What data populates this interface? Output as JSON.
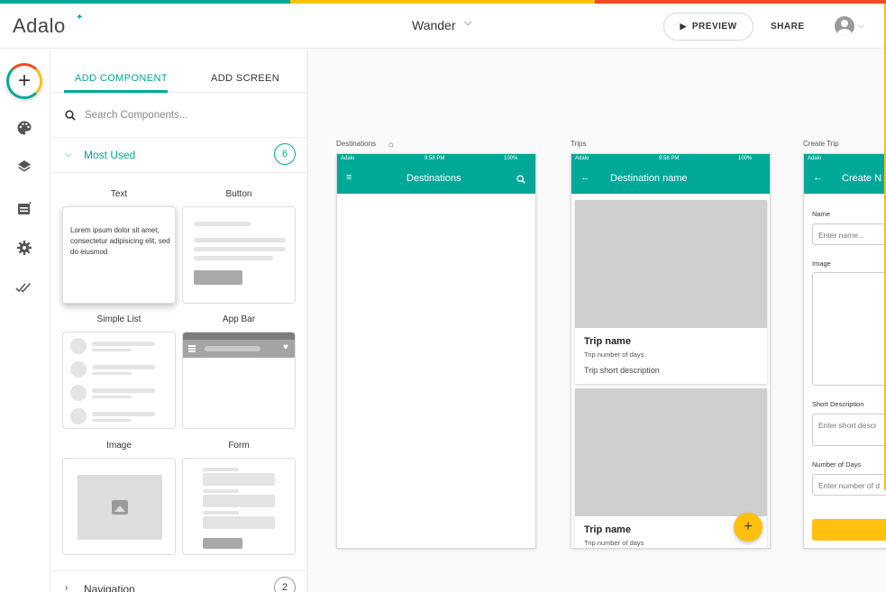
{
  "colors": {
    "brand_teal": "#00a898",
    "brand_yellow": "#ffc00e",
    "brand_red": "#f04b25"
  },
  "header": {
    "logo": "Adalo",
    "app_name": "Wander",
    "preview_label": "PREVIEW",
    "share_label": "SHARE"
  },
  "rail": {
    "icons": [
      "add-icon",
      "palette-icon",
      "layers-icon",
      "database-icon",
      "gear-icon",
      "publish-check-icon"
    ]
  },
  "panel": {
    "tabs": [
      {
        "label": "ADD COMPONENT"
      },
      {
        "label": "ADD SCREEN"
      }
    ],
    "search_placeholder": "Search Components...",
    "sections": [
      {
        "title": "Most Used",
        "count": "6"
      },
      {
        "title": "Navigation",
        "count": "2"
      }
    ],
    "components": [
      {
        "label": "Text",
        "preview_text": "Lorem ipsum dolor sit amet, consectetur adipisicing elit, sed do eiusmod"
      },
      {
        "label": "Button"
      },
      {
        "label": "Simple List"
      },
      {
        "label": "App Bar"
      },
      {
        "label": "Image"
      },
      {
        "label": "Form"
      }
    ]
  },
  "canvas": {
    "screens": [
      {
        "label": "Destinations",
        "carrier": "Adalo",
        "time": "9:58 PM",
        "battery": "100%",
        "title": "Destinations"
      },
      {
        "label": "Trips",
        "carrier": "Adalo",
        "time": "9:58 PM",
        "battery": "100%",
        "title": "Destination name",
        "cards": [
          {
            "name": "Trip name",
            "days": "Trip number of days",
            "desc": "Trip short description"
          },
          {
            "name": "Trip name",
            "days": "Trip number of days"
          }
        ],
        "fab": "+"
      },
      {
        "label": "Create Trip",
        "carrier": "Adalo",
        "title": "Create N",
        "fields": [
          {
            "label": "Name",
            "placeholder": "Enter name..."
          },
          {
            "label": "Image",
            "placeholder": ""
          },
          {
            "label": "Short Description",
            "placeholder": "Enter short descr"
          },
          {
            "label": "Number of Days",
            "placeholder": "Enter number of d"
          }
        ]
      }
    ]
  }
}
